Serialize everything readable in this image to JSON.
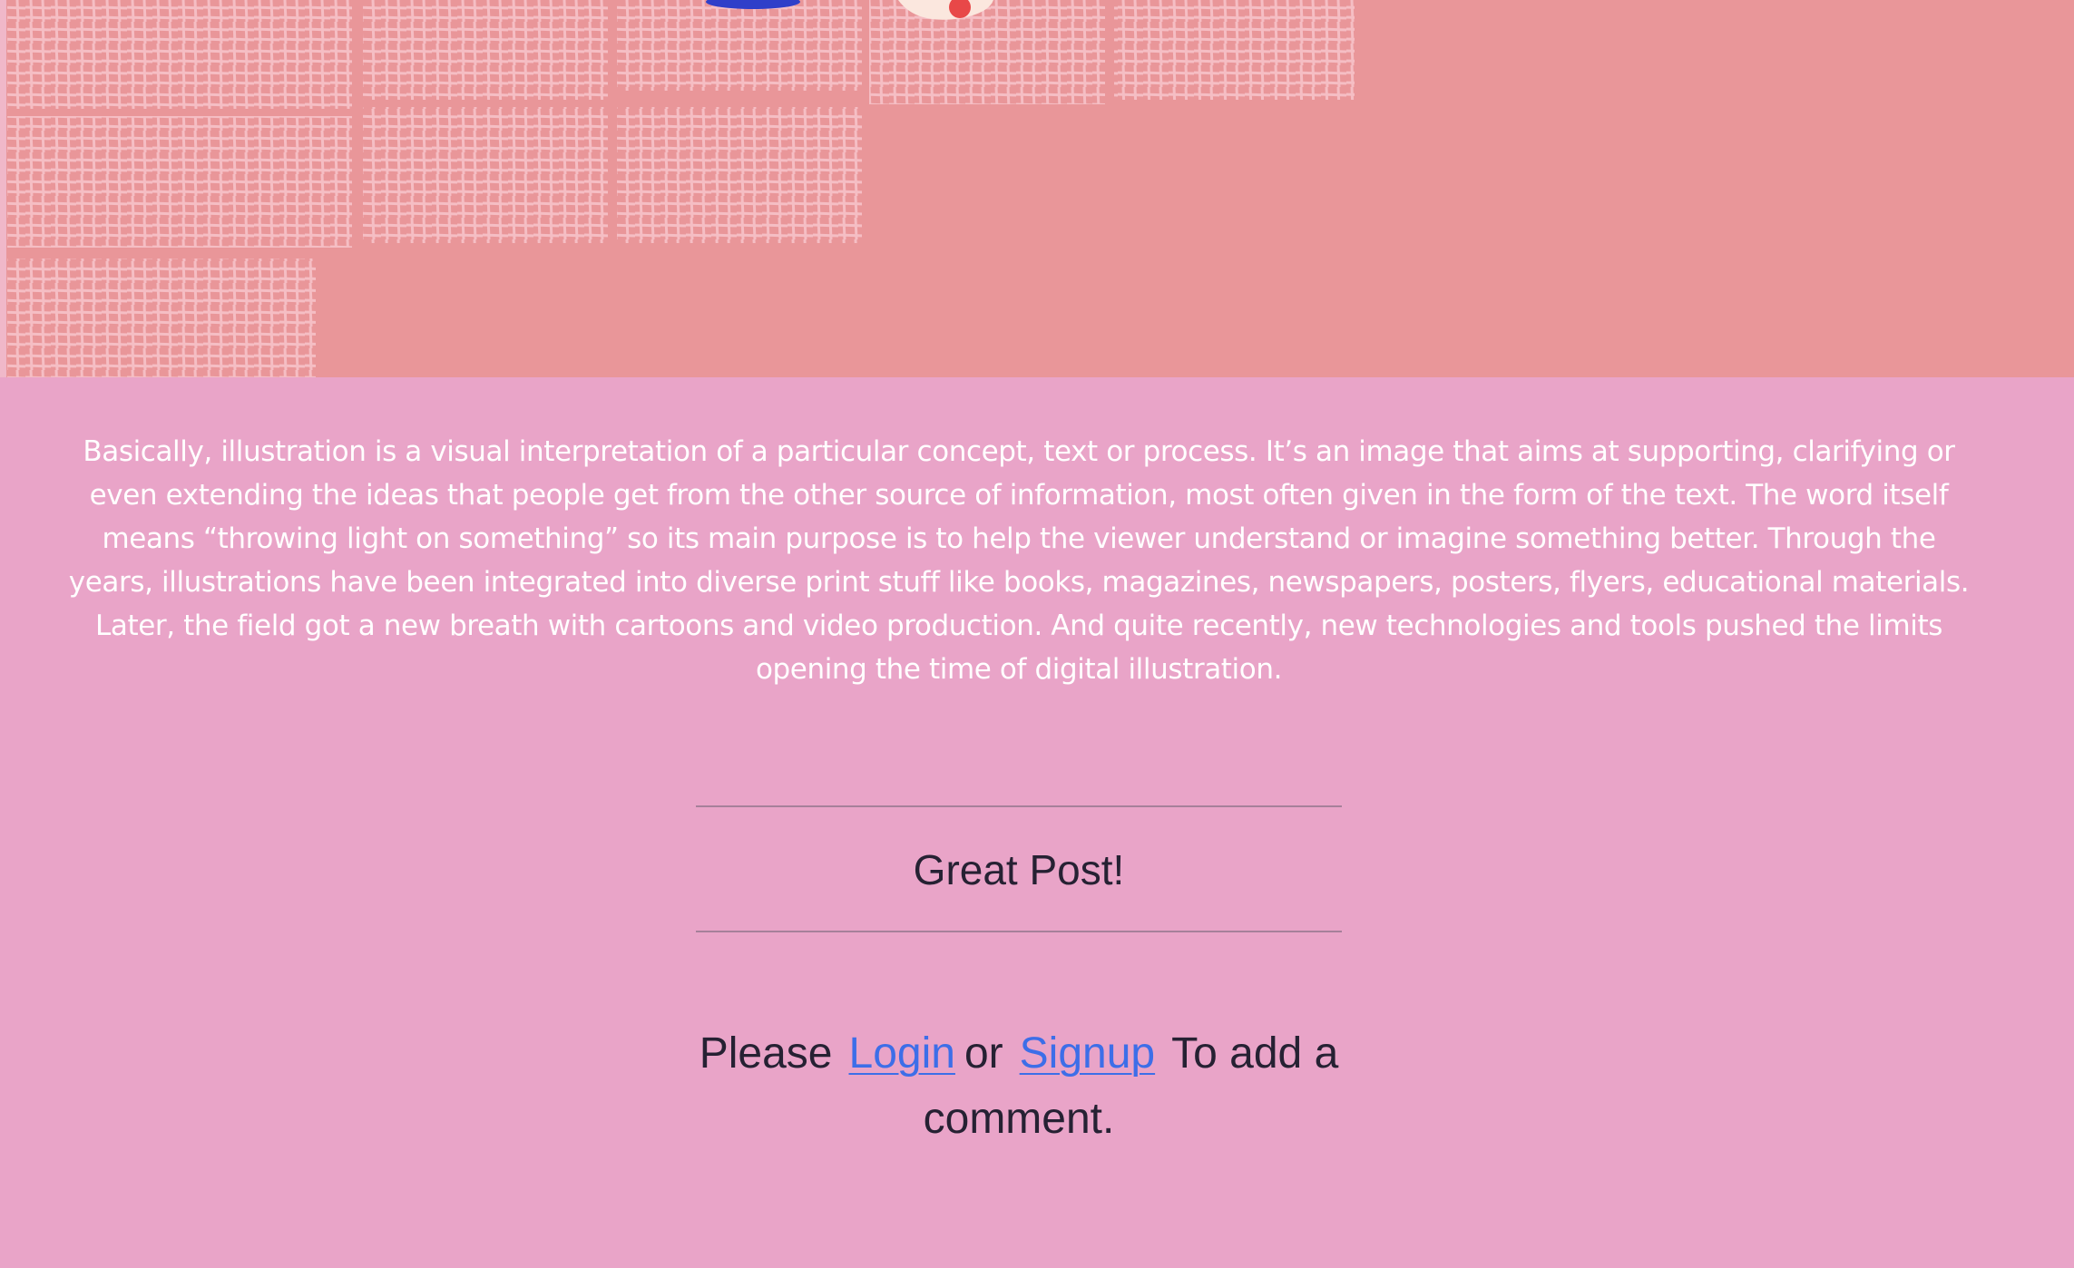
{
  "hero": {
    "background_color": "#e99699",
    "pattern_color": "#f6c0c6"
  },
  "article": {
    "body": "Basically, illustration is a visual interpretation of a particular concept, text or process. It’s an image that aims at supporting, clarifying or even extending the ideas that people get from the other source of information, most often given in the form of the text. The word itself means “throwing light on something” so its main purpose is to help the viewer understand or imagine something better. Through the years, illustrations have been integrated into diverse print stuff like books, magazines, newspapers, posters, flyers, educational materials. Later, the field got a new breath with cartoons and video production. And quite recently, new technologies and tools pushed the limits opening the time of digital illustration."
  },
  "comments": {
    "items": [
      {
        "text": "Great Post!"
      }
    ],
    "prompt_before": "Please",
    "login_label": "Login",
    "middle_text": "or",
    "signup_label": "Signup",
    "prompt_after": "To add a comment."
  },
  "colors": {
    "page_background": "#e9a4c8",
    "link": "#3d6ee8",
    "text_dark": "#262133",
    "text_light": "#ffffff"
  }
}
